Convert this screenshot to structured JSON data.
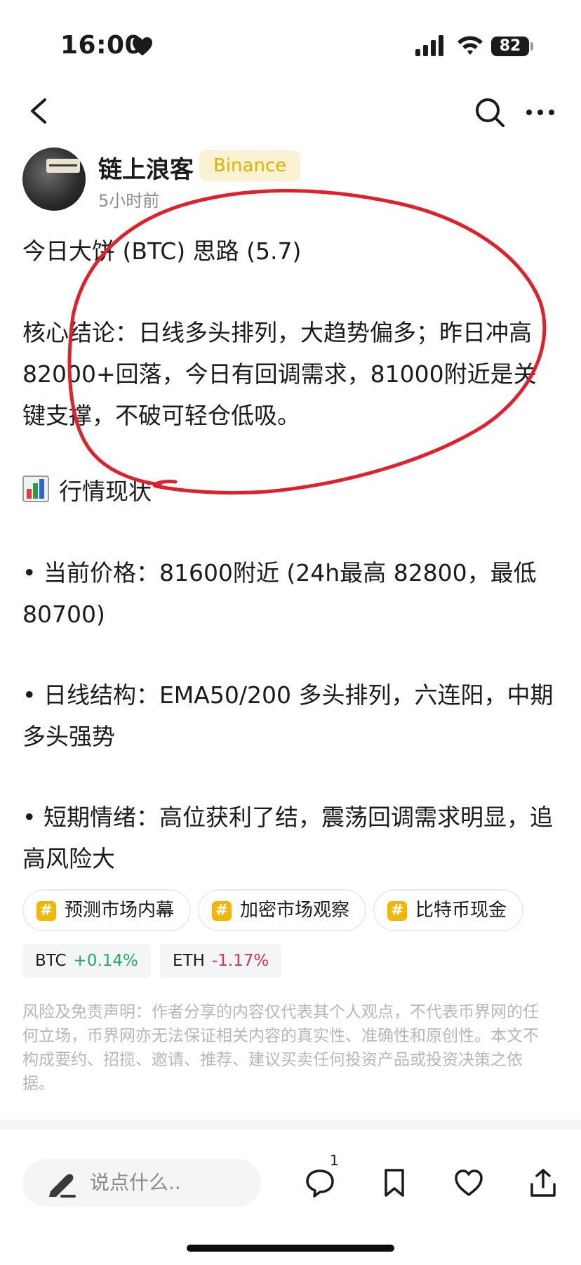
{
  "status_bar": {
    "time": "16:00",
    "battery": "82"
  },
  "author": {
    "name": "链上浪客",
    "badge": "Binance",
    "time_ago": "5小时前"
  },
  "post": {
    "title": "今日大饼 (BTC) 思路 (5.7)",
    "core_conclusion": "核心结论：日线多头排列，大趋势偏多；昨日冲高 82000+回落，今日有回调需求，81000附近是关键支撑，不破可轻仓低吸。",
    "section_heading": "行情现状",
    "bullets": [
      "• 当前价格：81600附近 (24h最高 82800，最低 80700)",
      "• 日线结构：EMA50/200 多头排列，六连阳，中期多头强势",
      "• 短期情绪：高位获利了结，震荡回调需求明显，追高风险大"
    ]
  },
  "tags": [
    {
      "label": "预测市场内幕",
      "icon": "hash-icon"
    },
    {
      "label": "加密市场观察",
      "icon": "hash-icon"
    },
    {
      "label": "比特币现金",
      "icon": "hash-icon"
    }
  ],
  "coins": [
    {
      "symbol": "BTC",
      "change": "+0.14%",
      "color": "#1fae5a"
    },
    {
      "symbol": "ETH",
      "change": "-1.17%",
      "color": "#e0334a"
    }
  ],
  "disclaimer": "风险及免责声明：作者分享的内容仅代表其个人观点，不代表币界网的任何立场，币界网亦无法保证相关内容的真实性、准确性和原创性。本文不构成要约、招揽、邀请、推荐、建议买卖任何投资产品或投资决策之依据。",
  "bottom_bar": {
    "comment_placeholder": "说点什么..",
    "comment_count": "1"
  },
  "colors": {
    "badge_bg": "#fbf1d3",
    "badge_text": "#e6b000",
    "scribble": "#e0202a",
    "tag_icon": "#f2b705"
  }
}
